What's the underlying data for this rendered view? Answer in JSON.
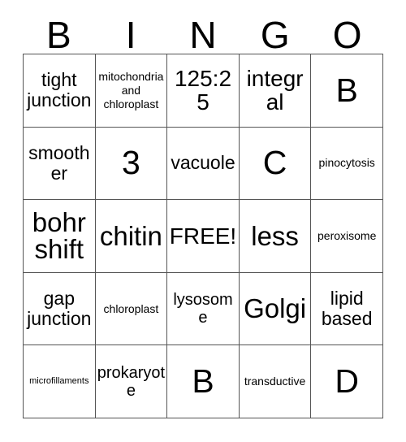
{
  "card": {
    "title": "BINGO",
    "header_letters": [
      "B",
      "I",
      "N",
      "G",
      "O"
    ],
    "free_space_label": "FREE!",
    "colors": {
      "background": "#ffffff",
      "text": "#000000",
      "grid_line": "#555555"
    },
    "rows": 5,
    "columns": 5,
    "cells": [
      [
        {
          "text": "tight junction",
          "size": "md"
        },
        {
          "text": "mitochondria and chloroplast",
          "size": "xs"
        },
        {
          "text": "125:25",
          "size": "lg"
        },
        {
          "text": "integral",
          "size": "lg"
        },
        {
          "text": "B",
          "size": "xxl"
        }
      ],
      [
        {
          "text": "smoother",
          "size": "md"
        },
        {
          "text": "3",
          "size": "xxl"
        },
        {
          "text": "vacuole",
          "size": "md"
        },
        {
          "text": "C",
          "size": "xxl"
        },
        {
          "text": "pinocytosis",
          "size": "xs"
        }
      ],
      [
        {
          "text": "bohr shift",
          "size": "xl"
        },
        {
          "text": "chitin",
          "size": "xl"
        },
        {
          "text": "FREE!",
          "size": "lg"
        },
        {
          "text": "less",
          "size": "xl"
        },
        {
          "text": "peroxisome",
          "size": "xs"
        }
      ],
      [
        {
          "text": "gap junction",
          "size": "md"
        },
        {
          "text": "chloroplast",
          "size": "xs"
        },
        {
          "text": "lysosome",
          "size": "sm"
        },
        {
          "text": "Golgi",
          "size": "xl"
        },
        {
          "text": "lipid based",
          "size": "md"
        }
      ],
      [
        {
          "text": "microfillaments",
          "size": "xxs"
        },
        {
          "text": "prokaryote",
          "size": "sm"
        },
        {
          "text": "B",
          "size": "xxl"
        },
        {
          "text": "transductive",
          "size": "xs"
        },
        {
          "text": "D",
          "size": "xxl"
        }
      ]
    ]
  }
}
